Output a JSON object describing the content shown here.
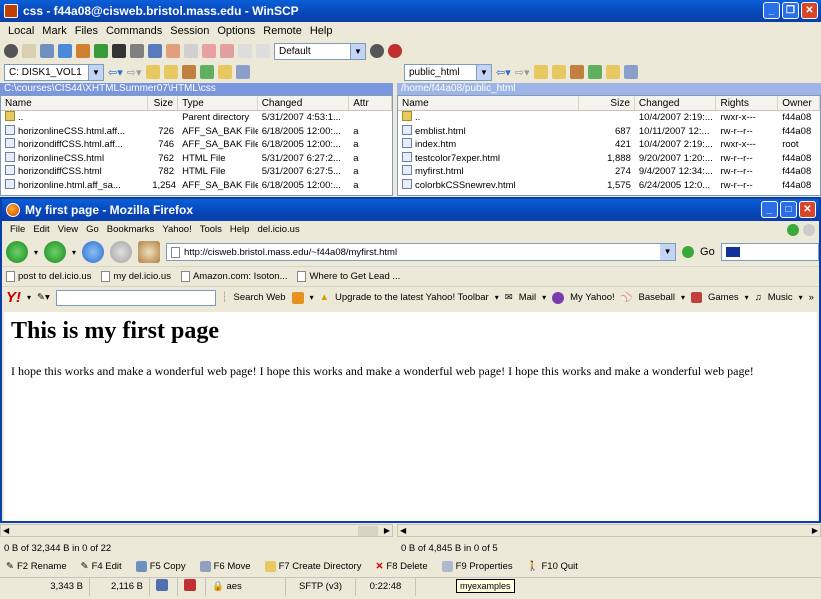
{
  "winscp": {
    "title": "css - f44a08@cisweb.bristol.mass.edu - WinSCP",
    "menu": [
      "Local",
      "Mark",
      "Files",
      "Commands",
      "Session",
      "Options",
      "Remote",
      "Help"
    ],
    "profile": "Default",
    "local_drive": "C: DISK1_VOL1",
    "remote_dir": "public_html",
    "local_path": "C:\\courses\\CIS44\\XHTMLSummer07\\HTML\\css",
    "remote_path": "/home/f44a08/public_html",
    "local_cols": [
      "Name",
      "Size",
      "Type",
      "Changed",
      "Attr"
    ],
    "remote_cols": [
      "Name",
      "Size",
      "Changed",
      "Rights",
      "Owner"
    ],
    "local_files": [
      {
        "name": "..",
        "size": "",
        "type": "Parent directory",
        "changed": "5/31/2007 4:53:1...",
        "attr": ""
      },
      {
        "name": "horizonlineCSS.html.aff...",
        "size": "726",
        "type": "AFF_SA_BAK File",
        "changed": "6/18/2005 12:00:...",
        "attr": "a"
      },
      {
        "name": "horizondiffCSS.html.aff...",
        "size": "746",
        "type": "AFF_SA_BAK File",
        "changed": "6/18/2005 12:00:...",
        "attr": "a"
      },
      {
        "name": "horizonlineCSS.html",
        "size": "762",
        "type": "HTML File",
        "changed": "5/31/2007 6:27:2...",
        "attr": "a"
      },
      {
        "name": "horizondiffCSS.html",
        "size": "782",
        "type": "HTML File",
        "changed": "5/31/2007 6:27:5...",
        "attr": "a"
      },
      {
        "name": "horizonline.html.aff_sa...",
        "size": "1,254",
        "type": "AFF_SA_BAK File",
        "changed": "6/18/2005 12:00:...",
        "attr": "a"
      }
    ],
    "remote_files": [
      {
        "name": "..",
        "size": "",
        "changed": "10/4/2007 2:19:...",
        "rights": "rwxr-x---",
        "owner": "f44a08"
      },
      {
        "name": "emblist.html",
        "size": "687",
        "changed": "10/11/2007 12:...",
        "rights": "rw-r--r--",
        "owner": "f44a08"
      },
      {
        "name": "index.htm",
        "size": "421",
        "changed": "10/4/2007 2:19:...",
        "rights": "rwxr-x---",
        "owner": "root"
      },
      {
        "name": "testcolor7exper.html",
        "size": "1,888",
        "changed": "9/20/2007 1:20:...",
        "rights": "rw-r--r--",
        "owner": "f44a08"
      },
      {
        "name": "myfirst.html",
        "size": "274",
        "changed": "9/4/2007 12:34:...",
        "rights": "rw-r--r--",
        "owner": "f44a08"
      },
      {
        "name": "colorbkCSSnewrev.html",
        "size": "1,575",
        "changed": "6/24/2005 12:0...",
        "rights": "rw-r--r--",
        "owner": "f44a08"
      }
    ],
    "local_status": "0 B of 32,344 B in 0 of 22",
    "remote_status": "0 B of 4,845 B in 0 of 5",
    "fkeys": [
      "F2 Rename",
      "F4 Edit",
      "F5 Copy",
      "F6 Move",
      "F7 Create Directory",
      "F8 Delete",
      "F9 Properties",
      "F10 Quit"
    ],
    "bottom": {
      "sent": "3,343 B",
      "recv": "2,116 B",
      "cipher": "aes",
      "protocol": "SFTP (v3)",
      "time": "0:22:48",
      "tooltip": "myexamples"
    }
  },
  "firefox": {
    "title": "My first page - Mozilla Firefox",
    "menu": [
      "File",
      "Edit",
      "View",
      "Go",
      "Bookmarks",
      "Yahoo!",
      "Tools",
      "Help",
      "del.icio.us"
    ],
    "url": "http://cisweb.bristol.mass.edu/~f44a08/myfirst.html",
    "go": "Go",
    "bookmarks": [
      "post to del.icio.us",
      "my del.icio.us",
      "Amazon.com: Isoton...",
      "Where to Get Lead ..."
    ],
    "yahoo": {
      "logo": "Y!",
      "search": "Search Web",
      "upgrade": "Upgrade to the latest Yahoo! Toolbar",
      "items": [
        "Mail",
        "My Yahoo!",
        "Baseball",
        "Games",
        "Music"
      ]
    },
    "page": {
      "heading": "This is my first page",
      "text": "I hope this works and make a wonderful web page! I hope this works and make a wonderful web page! I hope this works and make a wonderful web page!"
    }
  },
  "colors": {
    "title_blue": "#0846b8",
    "path_blue": "#7a96df",
    "yahoo_red": "#cc0000"
  }
}
